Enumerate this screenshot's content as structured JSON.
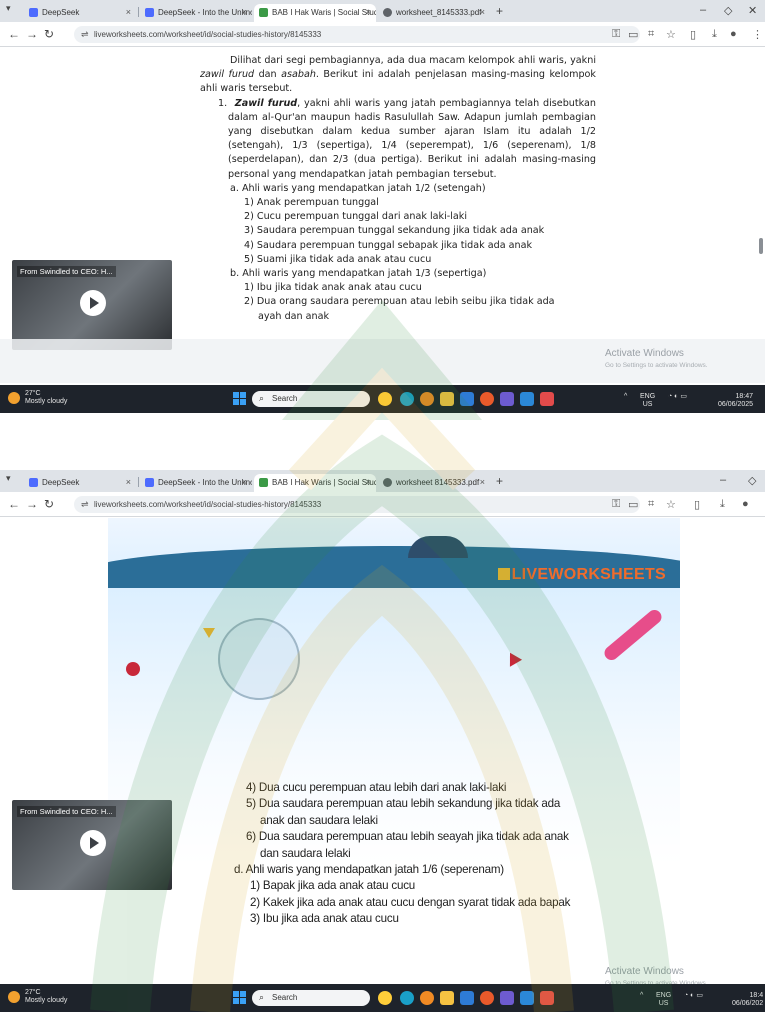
{
  "screenshot1": {
    "tabs": [
      {
        "label": "DeepSeek",
        "active": false
      },
      {
        "label": "DeepSeek - Into the Unknown",
        "active": false
      },
      {
        "label": "BAB I Hak Waris | Social Studie",
        "active": true
      },
      {
        "label": "worksheet_8145333.pdf",
        "active": false
      }
    ],
    "url": "liveworksheets.com/worksheet/id/social-studies-history/8145333",
    "video_title": "From Swindled to CEO: H...",
    "document": {
      "intro": "Dilihat dari segi pembagiannya, ada dua macam kelompok ahli waris, yakni",
      "intro_term1": "zawil furud",
      "intro_and": "dan",
      "intro_term2": "asabah",
      "intro_rest": ". Berikut ini adalah penjelasan masing-masing kelompok ahli waris tersebut.",
      "item1_num": "1.",
      "item1_term": "Zawil furud",
      "item1_text": ", yakni ahli waris yang jatah pembagiannya telah disebutkan dalam al-Qur'an maupun hadis Rasulullah Saw. Adapun jumlah pembagian yang disebutkan dalam kedua sumber ajaran Islam itu adalah 1/2 (setengah), 1/3 (sepertiga), 1/4 (seperempat), 1/6 (seperenam), 1/8 (seperdelapan), dan 2/3 (dua pertiga). Berikut ini adalah masing-masing personal yang mendapatkan jatah pembagian tersebut.",
      "sub_a": "a. Ahli waris yang mendapatkan jatah 1/2 (setengah)",
      "list_a": [
        "1) Anak perempuan tunggal",
        "2) Cucu perempuan tunggal dari anak laki-laki",
        "3) Saudara perempuan tunggal sekandung jika tidak ada anak",
        "4) Saudara perempuan tunggal sebapak jika tidak ada anak",
        "5) Suami jika tidak ada anak atau cucu"
      ],
      "sub_b": "b. Ahli waris yang mendapatkan jatah 1/3 (sepertiga)",
      "list_b": [
        "1) Ibu jika tidak anak anak atau cucu",
        "2) Dua orang saudara perempuan atau lebih seibu jika tidak ada"
      ],
      "list_b_cut": "ayah dan anak"
    },
    "activate_title": "Activate Windows",
    "activate_sub": "Go to Settings to activate Windows.",
    "weather_temp": "27°C",
    "weather_desc": "Mostly cloudy",
    "search_label": "Search",
    "tray_lang": "ENG",
    "tray_region": "US",
    "clock_time": "18:47",
    "clock_date": "06/06/2025"
  },
  "screenshot2": {
    "tabs": [
      {
        "label": "DeepSeek",
        "active": false
      },
      {
        "label": "DeepSeek - Into the Unknown",
        "active": false
      },
      {
        "label": "BAB I Hak Waris | Social Studie",
        "active": true
      },
      {
        "label": "worksheet 8145333.pdf",
        "active": false
      }
    ],
    "url": "liveworksheets.com/worksheet/id/social-studies-history/8145333",
    "brand": "LIVEWORKSHEETS",
    "video_title": "From Swindled to CEO: H...",
    "worksheet_lines": [
      {
        "text": "4) Dua cucu perempuan atau lebih dari anak laki-laki",
        "cls": "n"
      },
      {
        "text": "5) Dua saudara perempuan atau lebih sekandung jika tidak ada",
        "cls": "n"
      },
      {
        "text": "anak dan saudara lelaki",
        "cls": "cont"
      },
      {
        "text": "6) Dua saudara perempuan atau lebih seayah jika tidak ada anak",
        "cls": "n"
      },
      {
        "text": "dan saudara lelaki",
        "cls": "cont"
      },
      {
        "text": "d. Ahli waris yang mendapatkan jatah 1/6 (seperenam)",
        "cls": "d"
      },
      {
        "text": "1) Bapak jika ada anak atau cucu",
        "cls": "m"
      },
      {
        "text": "2) Kakek jika ada anak atau cucu dengan syarat tidak ada bapak",
        "cls": "m"
      },
      {
        "text": "3) Ibu jika ada anak atau cucu",
        "cls": "m"
      }
    ],
    "activate_title": "Activate Windows",
    "activate_sub": "Go to Settings to activate Windows.",
    "weather_temp": "27°C",
    "weather_desc": "Mostly cloudy",
    "search_label": "Search",
    "tray_lang": "ENG",
    "tray_region": "US",
    "clock_time": "18:4",
    "clock_date": "06/06/202"
  },
  "colors": {
    "taskbar": "#1e232b",
    "brand_orange": "#ef6c2c",
    "watermark_green": "#2e8b3a",
    "watermark_gold": "#d7a71c"
  }
}
